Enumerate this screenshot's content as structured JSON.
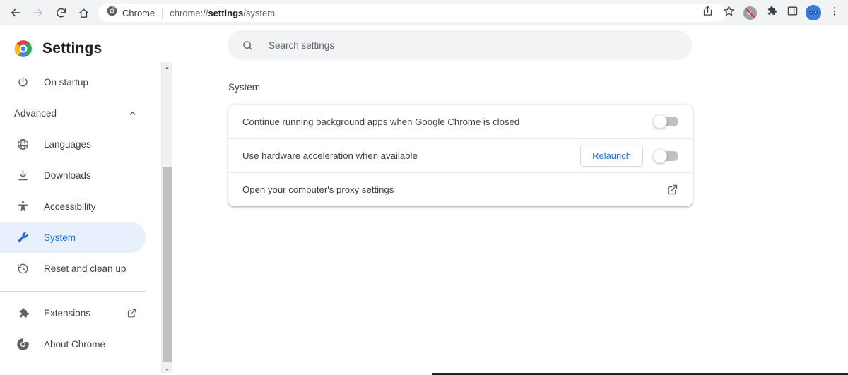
{
  "browser": {
    "nav": {
      "back_icon": "arrow-left-icon",
      "forward_icon": "arrow-right-icon",
      "reload_icon": "reload-icon",
      "home_icon": "home-icon"
    },
    "omnibox": {
      "site_icon": "chrome-logo-icon",
      "site_label": "Chrome",
      "url_prefix": "chrome://",
      "url_bold": "settings",
      "url_suffix": "/system"
    },
    "actions": [
      {
        "name": "share-icon",
        "label": "Share"
      },
      {
        "name": "bookmark-star-icon",
        "label": "Bookmark this tab"
      },
      {
        "name": "media-muted-icon",
        "label": "Media control"
      },
      {
        "name": "extensions-puzzle-icon",
        "label": "Extensions"
      },
      {
        "name": "side-panel-icon",
        "label": "Side panel"
      },
      {
        "name": "profile-avatar-icon",
        "label": "Profile"
      },
      {
        "name": "three-dot-menu-icon",
        "label": "Customize and control Google Chrome"
      }
    ]
  },
  "sidebar": {
    "title": "Settings",
    "logo_icon": "chrome-logo-icon",
    "items": [
      {
        "label": "On startup",
        "icon": "power-icon",
        "selected": false,
        "external": false
      },
      {
        "label": "Languages",
        "icon": "globe-icon",
        "selected": false,
        "external": false
      },
      {
        "label": "Downloads",
        "icon": "download-icon",
        "selected": false,
        "external": false
      },
      {
        "label": "Accessibility",
        "icon": "accessibility-icon",
        "selected": false,
        "external": false
      },
      {
        "label": "System",
        "icon": "wrench-icon",
        "selected": true,
        "external": false
      },
      {
        "label": "Reset and clean up",
        "icon": "restore-icon",
        "selected": false,
        "external": false
      },
      {
        "label": "Extensions",
        "icon": "extensions-puzzle-icon",
        "selected": false,
        "external": true
      },
      {
        "label": "About Chrome",
        "icon": "chrome-outline-icon",
        "selected": false,
        "external": false
      }
    ],
    "advanced": {
      "label": "Advanced",
      "expanded": true,
      "chevron_icon": "chevron-up-icon"
    },
    "scrollbar": {
      "up_arrow_icon": "scroll-up-arrow-icon",
      "down_arrow_icon": "scroll-down-arrow-icon"
    }
  },
  "main": {
    "search": {
      "placeholder": "Search settings",
      "value": "",
      "icon": "search-icon"
    },
    "section_title": "System",
    "rows": [
      {
        "label": "Continue running background apps when Google Chrome is closed",
        "control": "toggle",
        "toggle_on": false,
        "button_label": "",
        "trailing_icon": ""
      },
      {
        "label": "Use hardware acceleration when available",
        "control": "toggle",
        "toggle_on": false,
        "button_label": "Relaunch",
        "trailing_icon": ""
      },
      {
        "label": "Open your computer's proxy settings",
        "control": "external-link",
        "toggle_on": false,
        "button_label": "",
        "trailing_icon": "external-link-icon"
      }
    ]
  },
  "colors": {
    "accent": "#1a73e8",
    "selected_bg": "#e8f0fe",
    "toolbar_bg": "#f1f3f4",
    "text_primary": "#3c4043",
    "text_secondary": "#5f6368",
    "toggle_off_track": "#bdc1c6"
  }
}
